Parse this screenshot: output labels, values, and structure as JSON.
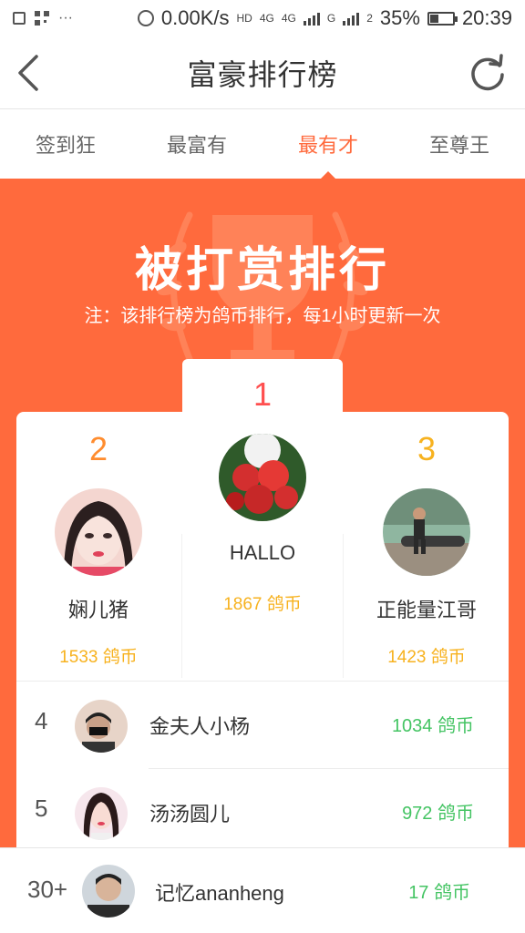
{
  "status_bar": {
    "dots": "···",
    "speed": "0.00K/s",
    "hd": "HD",
    "net1": "4G",
    "net2": "4G",
    "net3": "G",
    "sim": "2",
    "battery": "35%",
    "time": "20:39"
  },
  "nav": {
    "title": "富豪排行榜",
    "back_icon": "back-arrow-icon",
    "refresh_icon": "refresh-icon"
  },
  "tabs": [
    {
      "label": "签到狂",
      "active": false
    },
    {
      "label": "最富有",
      "active": false
    },
    {
      "label": "最有才",
      "active": true
    },
    {
      "label": "至尊王",
      "active": false
    }
  ],
  "banner": {
    "title": "被打赏排行",
    "note": "注：该排行榜为鸽币排行，每1小时更新一次",
    "background_color": "#ff6a3d"
  },
  "podium": [
    {
      "rank": "1",
      "name": "HALLO",
      "score": "1867 鸽币",
      "rank_color": "#ff4f4f"
    },
    {
      "rank": "2",
      "name": "娴儿猪",
      "score": "1533 鸽币",
      "rank_color": "#ff8c2e"
    },
    {
      "rank": "3",
      "name": "正能量江哥",
      "score": "1423 鸽币",
      "rank_color": "#f7b21f"
    }
  ],
  "list": [
    {
      "rank": "4",
      "name": "金夫人小杨",
      "score": "1034 鸽币"
    },
    {
      "rank": "5",
      "name": "汤汤圆儿",
      "score": "972 鸽币"
    }
  ],
  "self_row": {
    "rank": "30+",
    "name": "记忆ananheng",
    "score": "17 鸽币"
  },
  "colors": {
    "accent": "#ff6a3d",
    "score_gold": "#f7b21f",
    "score_green": "#44c463"
  }
}
